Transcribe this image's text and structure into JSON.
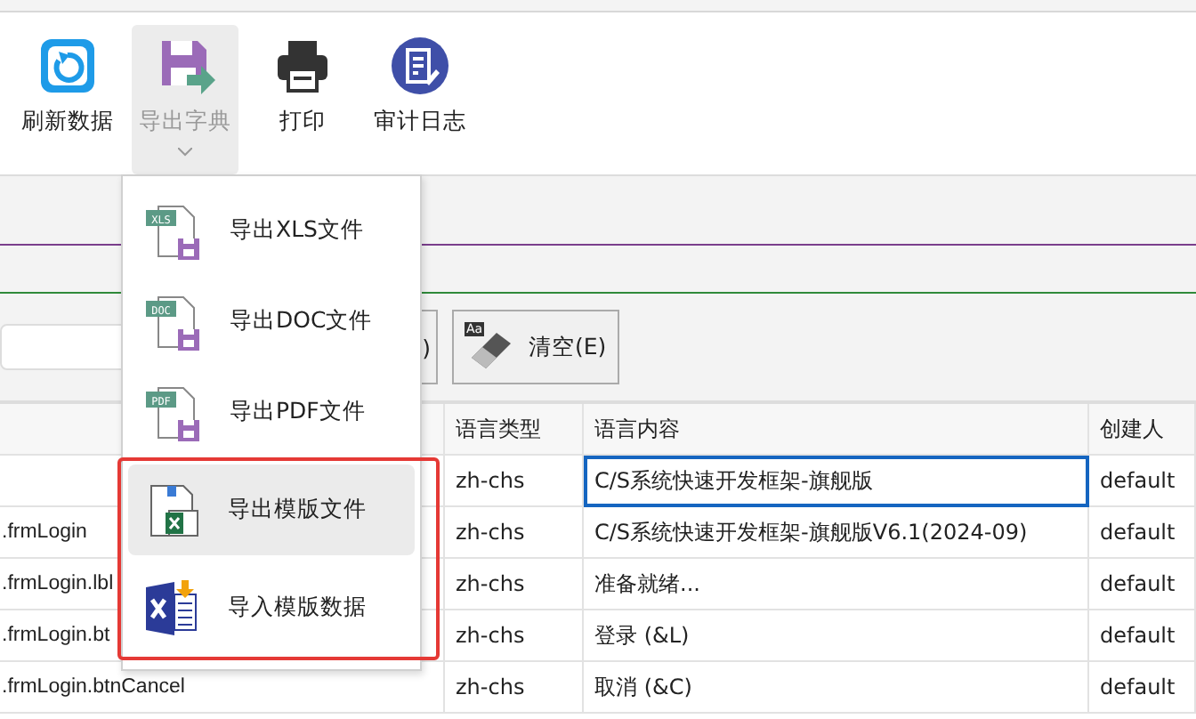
{
  "toolbar": [
    {
      "label": "刷新数据",
      "kind": "refresh",
      "selected": false
    },
    {
      "label": "导出字典",
      "kind": "export",
      "selected": true
    },
    {
      "label": "打印",
      "kind": "print",
      "selected": false
    },
    {
      "label": "审计日志",
      "kind": "audit",
      "selected": false
    }
  ],
  "search": {
    "buttons": [
      {
        "label": ")",
        "kind": "clipped"
      },
      {
        "label": "清空(E)",
        "kind": "clear",
        "badge": "Aa"
      }
    ]
  },
  "table": {
    "columns": [
      "语言类型",
      "语言内容",
      "创建人"
    ],
    "rows": [
      {
        "language": "zh-chs",
        "content": "C/S系统快速开发框架-旗舰版",
        "creator": "default",
        "focused": true
      },
      {
        "column_1": ".frmLogin",
        "language": "zh-chs",
        "content": "C/S系统快速开发框架-旗舰版V6.1(2024-09)",
        "creator": "default",
        "focused": false
      },
      {
        "column_1": ".frmLogin.lbl",
        "language": "zh-chs",
        "content": "准备就绪...",
        "creator": "default",
        "focused": false
      },
      {
        "column_1": ".frmLogin.bt",
        "language": "zh-chs",
        "content": "登录 (&L)",
        "creator": "default",
        "focused": false
      },
      {
        "column_1": ".frmLogin.btnCancel",
        "language": "zh-chs",
        "content": "取消 (&C)",
        "creator": "default",
        "focused": false
      }
    ]
  },
  "menu": {
    "items": [
      {
        "label": "导出XLS文件",
        "kind": "file",
        "badge": "XLS",
        "selected": false,
        "highlighted": false
      },
      {
        "label": "导出DOC文件",
        "kind": "file",
        "badge": "DOC",
        "selected": false,
        "highlighted": false
      },
      {
        "label": "导出PDF文件",
        "kind": "file",
        "badge": "PDF",
        "selected": false,
        "highlighted": false
      },
      {
        "label": "导出模版文件",
        "kind": "template-export",
        "selected": true,
        "highlighted": true
      },
      {
        "label": "导入模版数据",
        "kind": "template-import",
        "selected": false,
        "highlighted": true
      }
    ]
  }
}
